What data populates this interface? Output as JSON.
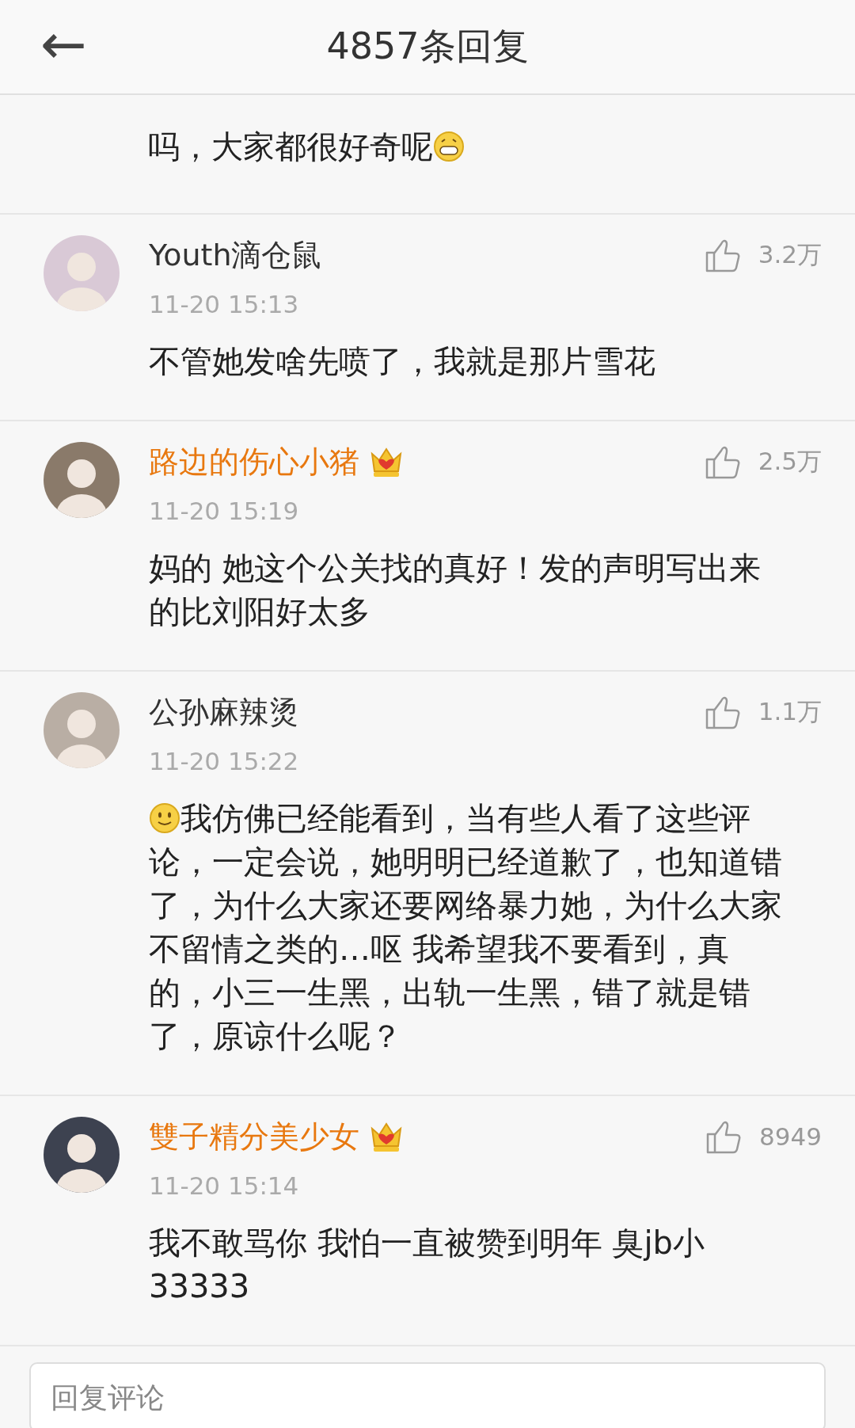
{
  "header": {
    "back": "←",
    "title": "4857条回复"
  },
  "partial_comment": {
    "segments": [
      {
        "kind": "text",
        "text": "吗，大家都很好奇呢"
      },
      {
        "kind": "grin"
      }
    ]
  },
  "comments": [
    {
      "name": "Youth滴仓鼠",
      "vip": false,
      "likes": "3.2万",
      "time": "11-20 15:13",
      "segments": [
        {
          "kind": "text",
          "text": "不管她发啥先喷了，我就是那片雪花"
        }
      ]
    },
    {
      "name": "路边的伤心小猪",
      "vip": true,
      "likes": "2.5万",
      "time": "11-20 15:19",
      "segments": [
        {
          "kind": "text",
          "text": "妈的 她这个公关找的真好！发的声明写出来的比刘阳好太多"
        }
      ]
    },
    {
      "name": "公孙麻辣烫",
      "vip": false,
      "likes": "1.1万",
      "time": "11-20 15:22",
      "segments": [
        {
          "kind": "smile"
        },
        {
          "kind": "text",
          "text": "我仿佛已经能看到，当有些人看了这些评论，一定会说，她明明已经道歉了，也知道错了，为什么大家还要网络暴力她，为什么大家不留情之类的…呕 我希望我不要看到，真的，小三一生黑，出轨一生黑，错了就是错了，原谅什么呢？"
        }
      ]
    },
    {
      "name": "雙子精分美少女",
      "vip": true,
      "likes": "8949",
      "time": "11-20 15:14",
      "segments": [
        {
          "kind": "text",
          "text": "我不敢骂你 我怕一直被赞到明年 臭jb小33333"
        }
      ]
    }
  ],
  "reply_box": {
    "placeholder": "回复评论"
  }
}
